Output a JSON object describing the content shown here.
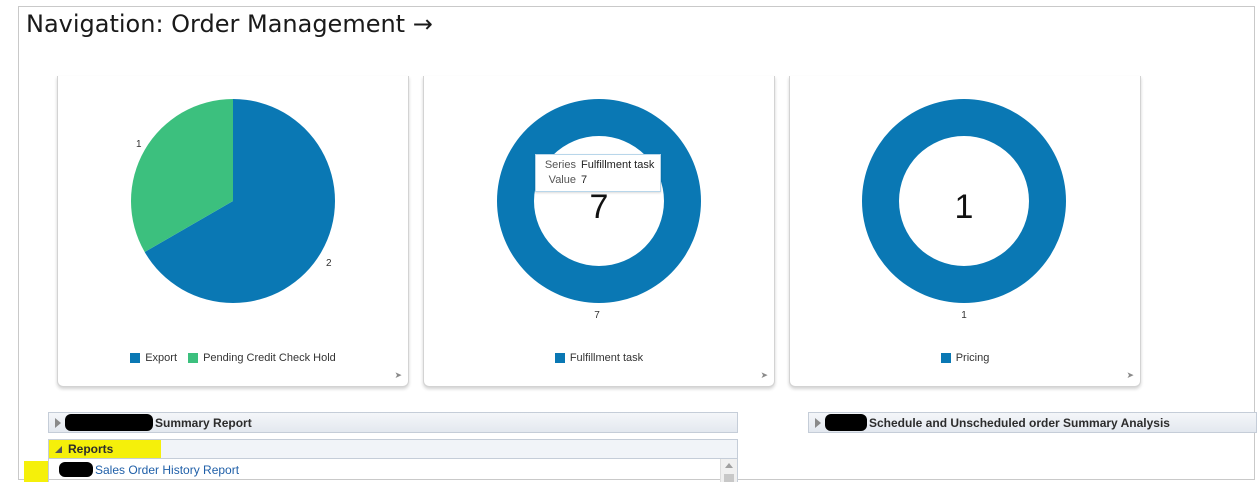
{
  "page_title": "Navigation: Order Management →",
  "cards": [
    {
      "chart_data": {
        "type": "pie",
        "slices": [
          {
            "label": "Export",
            "value": 2,
            "color": "#0a78b4"
          },
          {
            "label": "Pending Credit Check Hold",
            "value": 1,
            "color": "#3cc07e"
          }
        ],
        "data_labels": [
          "2",
          "1"
        ]
      },
      "legend": [
        {
          "label": "Export",
          "color": "#0a78b4"
        },
        {
          "label": "Pending Credit Check Hold",
          "color": "#3cc07e"
        }
      ]
    },
    {
      "chart_data": {
        "type": "pie",
        "donut": true,
        "slices": [
          {
            "label": "Fulfillment task",
            "value": 7,
            "color": "#0a78b4"
          }
        ],
        "center_value": "7",
        "data_labels": [
          "7"
        ]
      },
      "legend": [
        {
          "label": "Fulfillment task",
          "color": "#0a78b4"
        }
      ],
      "tooltip": {
        "series_key": "Series",
        "series_value": "Fulfillment task",
        "value_key": "Value",
        "value_value": "7"
      }
    },
    {
      "chart_data": {
        "type": "pie",
        "donut": true,
        "slices": [
          {
            "label": "Pricing",
            "value": 1,
            "color": "#0a78b4"
          }
        ],
        "center_value": "1",
        "data_labels": [
          "1"
        ]
      },
      "legend": [
        {
          "label": "Pricing",
          "color": "#0a78b4"
        }
      ]
    }
  ],
  "panels": {
    "summary_report": "Summary Report",
    "schedule_analysis": "Schedule and Unscheduled order Summary Analysis",
    "reports": "Reports",
    "report_link": "Sales Order History Report"
  },
  "icons": {
    "expand": "expand-arrow-icon",
    "collapsed": "disclosure-collapsed-icon",
    "expanded": "disclosure-expanded-icon"
  }
}
